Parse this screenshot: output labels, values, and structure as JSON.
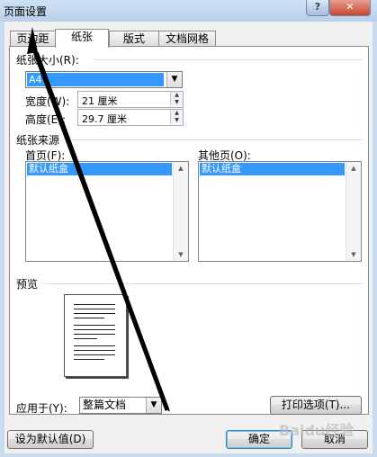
{
  "window": {
    "title": "页面设置",
    "help_label": "?",
    "close_label": "✕"
  },
  "tabs": [
    {
      "label": "页边距"
    },
    {
      "label": "纸张"
    },
    {
      "label": "版式"
    },
    {
      "label": "文档网格"
    }
  ],
  "paper_size": {
    "group_label": "纸张大小(R):",
    "selected": "A4",
    "width_label": "宽度(W):",
    "width_value": "21 厘米",
    "height_label": "高度(E):",
    "height_value": "29.7 厘米"
  },
  "paper_source": {
    "group_label": "纸张来源",
    "first_page_label": "首页(F):",
    "first_page_selected": "默认纸盒",
    "other_pages_label": "其他页(O):",
    "other_pages_selected": "默认纸盒"
  },
  "preview": {
    "group_label": "预览"
  },
  "apply_to": {
    "label": "应用于(Y):",
    "value": "整篇文档"
  },
  "buttons": {
    "print_options": "打印选项(T)...",
    "set_default": "设为默认值(D)",
    "ok": "确定",
    "cancel": "取消"
  },
  "watermark": "Baidu经验"
}
